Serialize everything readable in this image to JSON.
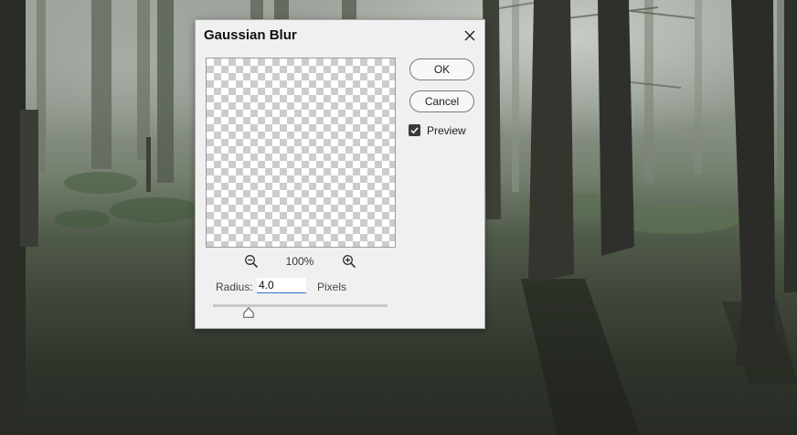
{
  "dialog": {
    "title": "Gaussian Blur",
    "ok_label": "OK",
    "cancel_label": "Cancel",
    "preview_label": "Preview",
    "preview_checked": true,
    "zoom_level": "100%",
    "radius_label": "Radius:",
    "radius_value": "4.0",
    "units_label": "Pixels",
    "radius_slider_fraction": 0.13
  },
  "icons": {
    "close": "close-icon",
    "zoom_out": "zoom-out-icon",
    "zoom_in": "zoom-in-icon",
    "checkbox": "checkmark-icon",
    "slider": "slider-thumb-icon"
  },
  "colors": {
    "dialog_background": "#f0f0f0",
    "input_focus_underline": "#2d6fd0",
    "checkbox_fill": "#3a3a3a"
  }
}
